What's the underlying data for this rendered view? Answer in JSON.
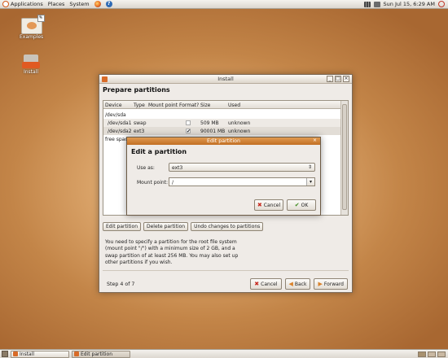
{
  "top_panel": {
    "menus": [
      "Applications",
      "Places",
      "System"
    ],
    "clock": "Sun Jul 15,  6:29 AM"
  },
  "desktop": {
    "icons": [
      {
        "label": "Examples"
      },
      {
        "label": "Install"
      }
    ]
  },
  "installer": {
    "window_title": "Install",
    "heading": "Prepare partitions",
    "table": {
      "headers": [
        "Device",
        "Type",
        "Mount point",
        "Format?",
        "Size",
        "Used"
      ],
      "rows": [
        {
          "device": "/dev/sda",
          "type": "",
          "mount": "",
          "format": "",
          "size": "",
          "used": ""
        },
        {
          "device": "/dev/sda1",
          "type": "swap",
          "mount": "",
          "format": "",
          "size": "509 MB",
          "used": "unknown"
        },
        {
          "device": "/dev/sda2",
          "type": "ext3",
          "mount": "",
          "format": "✔",
          "size": "90001 MB",
          "used": "unknown"
        },
        {
          "device": "free spac",
          "type": "",
          "mount": "",
          "format": "",
          "size": "",
          "used": ""
        }
      ]
    },
    "buttons": {
      "edit": "Edit partition",
      "delete": "Delete partition",
      "undo": "Undo changes to partitions"
    },
    "hint": "You need to specify a partition for the root file system (mount point \"/\") with a minimum size of 2 GB, and a swap partition of at least 256 MB. You may also set up other partitions if you wish.",
    "step": "Step 4 of 7",
    "nav": {
      "cancel": "Cancel",
      "back": "Back",
      "forward": "Forward"
    }
  },
  "dialog": {
    "title": "Edit partition",
    "heading": "Edit a partition",
    "use_as_label": "Use as:",
    "use_as_value": "ext3",
    "mount_label": "Mount point:",
    "mount_value": "/",
    "cancel": "Cancel",
    "ok": "OK"
  },
  "taskbar": {
    "items": [
      "Install",
      "Edit partition"
    ]
  }
}
